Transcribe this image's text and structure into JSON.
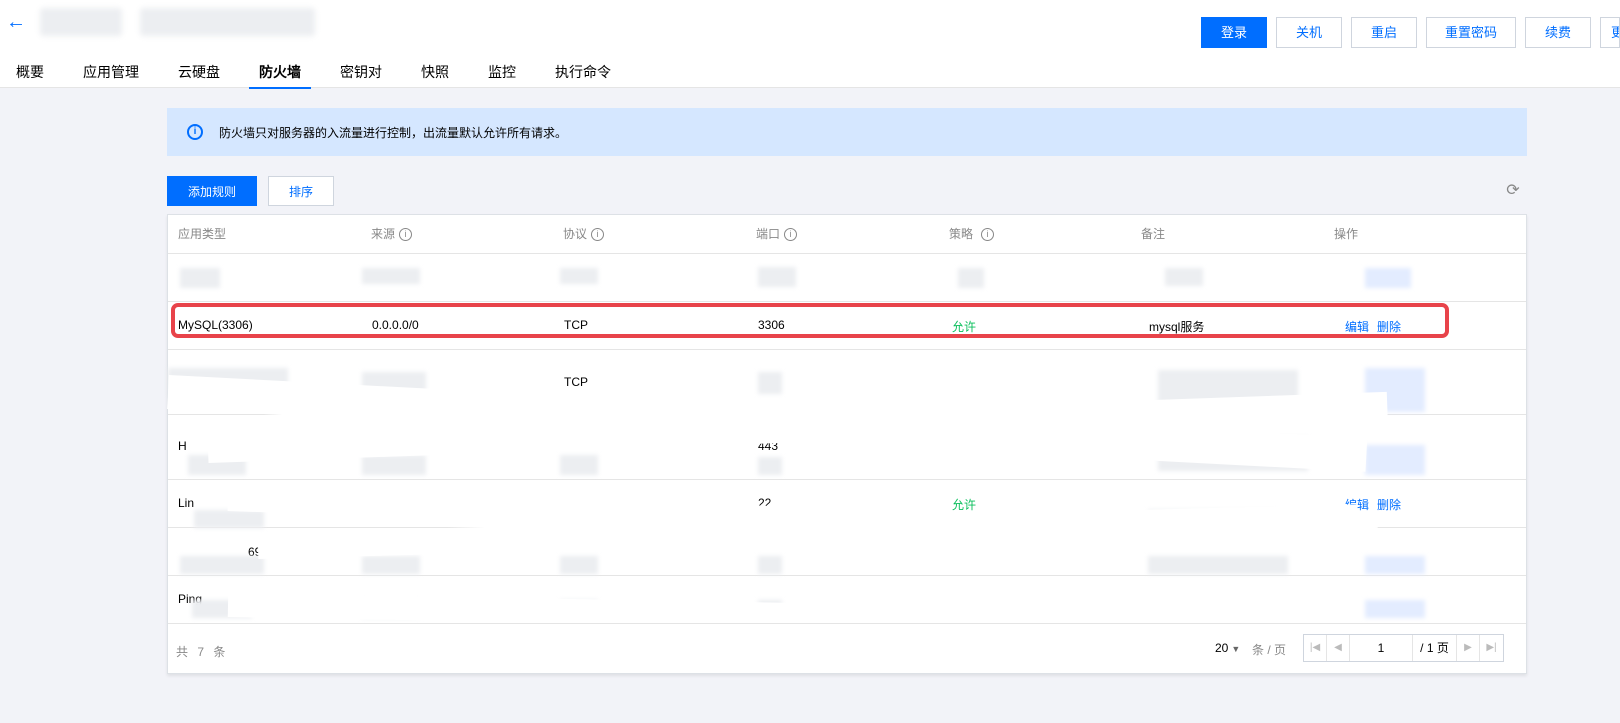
{
  "header": {
    "back_icon": "arrow-left-icon",
    "actions": [
      "登录",
      "关机",
      "重启",
      "重置密码",
      "续费",
      "更"
    ]
  },
  "tabs": [
    {
      "label": "概要",
      "active": false
    },
    {
      "label": "应用管理",
      "active": false
    },
    {
      "label": "云硬盘",
      "active": false
    },
    {
      "label": "防火墙",
      "active": true
    },
    {
      "label": "密钥对",
      "active": false
    },
    {
      "label": "快照",
      "active": false
    },
    {
      "label": "监控",
      "active": false
    },
    {
      "label": "执行命令",
      "active": false
    }
  ],
  "banner": {
    "icon": "info-icon",
    "text": "防火墙只对服务器的入流量进行控制，出流量默认允许所有请求。"
  },
  "toolbar": {
    "add_label": "添加规则",
    "sort_label": "排序",
    "refresh_icon": "refresh-icon"
  },
  "table": {
    "columns": [
      "应用类型",
      "来源",
      "协议",
      "端口",
      "策略",
      "备注",
      "操作"
    ],
    "rows": [
      {
        "app": "",
        "source": "",
        "protocol": "",
        "port": "",
        "policy": "",
        "note": "",
        "edit": "",
        "delete": ""
      },
      {
        "app": "MySQL(3306)",
        "source": "0.0.0.0/0",
        "protocol": "TCP",
        "port": "3306",
        "policy": "允许",
        "note": "mysql服务",
        "edit": "编辑",
        "delete": "删除"
      },
      {
        "app": "",
        "source": "",
        "protocol": "TCP",
        "port": "",
        "policy": "",
        "note": "",
        "edit": "",
        "delete": ""
      },
      {
        "app": "H",
        "source": "",
        "protocol": "",
        "port": "443",
        "policy": "",
        "note": "",
        "edit": "",
        "delete": ""
      },
      {
        "app": "Lin",
        "source": "",
        "protocol": "",
        "port": "22",
        "policy": "允许",
        "note": "",
        "edit": "编辑",
        "delete": "删除"
      },
      {
        "app": "69)",
        "source": "",
        "protocol": "",
        "port": "",
        "policy": "",
        "note": "",
        "edit": "",
        "delete": ""
      },
      {
        "app": "Ping",
        "source": "",
        "protocol": "",
        "port": "",
        "policy": "",
        "note": "",
        "edit": "",
        "delete": ""
      }
    ]
  },
  "footer": {
    "total": "共 7 条",
    "page_size": "20",
    "per_page": "条 / 页",
    "current_page": "1",
    "total_pages": "/ 1 页"
  },
  "colors": {
    "primary": "#006eff",
    "allow": "#0abf5b",
    "highlight": "#e8434a",
    "banner_bg": "#d5e7ff"
  }
}
